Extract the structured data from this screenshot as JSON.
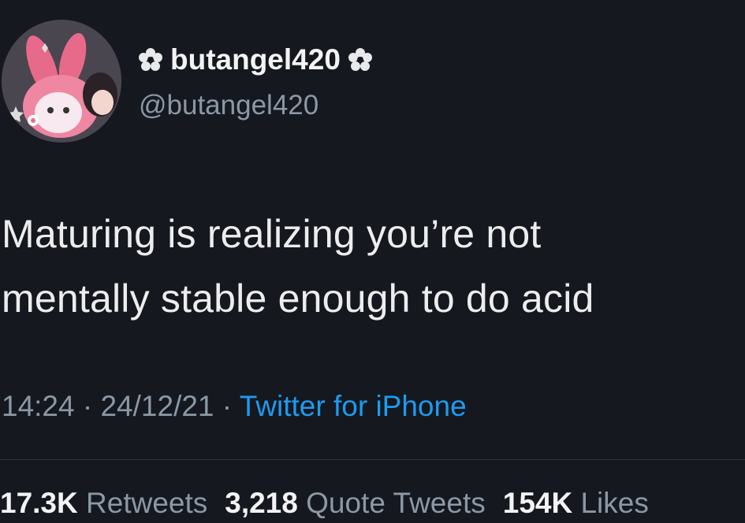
{
  "user": {
    "display_name": "butangel420",
    "handle": "@butangel420",
    "name_icon": "flower-icon"
  },
  "tweet": {
    "line1": "Maturing is realizing you’re not",
    "line2": "mentally stable enough to do acid"
  },
  "meta": {
    "time": "14:24",
    "separator": "·",
    "date": "24/12/21",
    "source": "Twitter for iPhone"
  },
  "stats": {
    "retweets_count": "17.3K",
    "retweets_label": "Retweets",
    "quotes_count": "3,218",
    "quotes_label": "Quote Tweets",
    "likes_count": "154K",
    "likes_label": "Likes"
  },
  "colors": {
    "background": "#15181f",
    "link": "#1d9bf0",
    "muted": "#8b98a5",
    "text": "#e7e9ea"
  }
}
